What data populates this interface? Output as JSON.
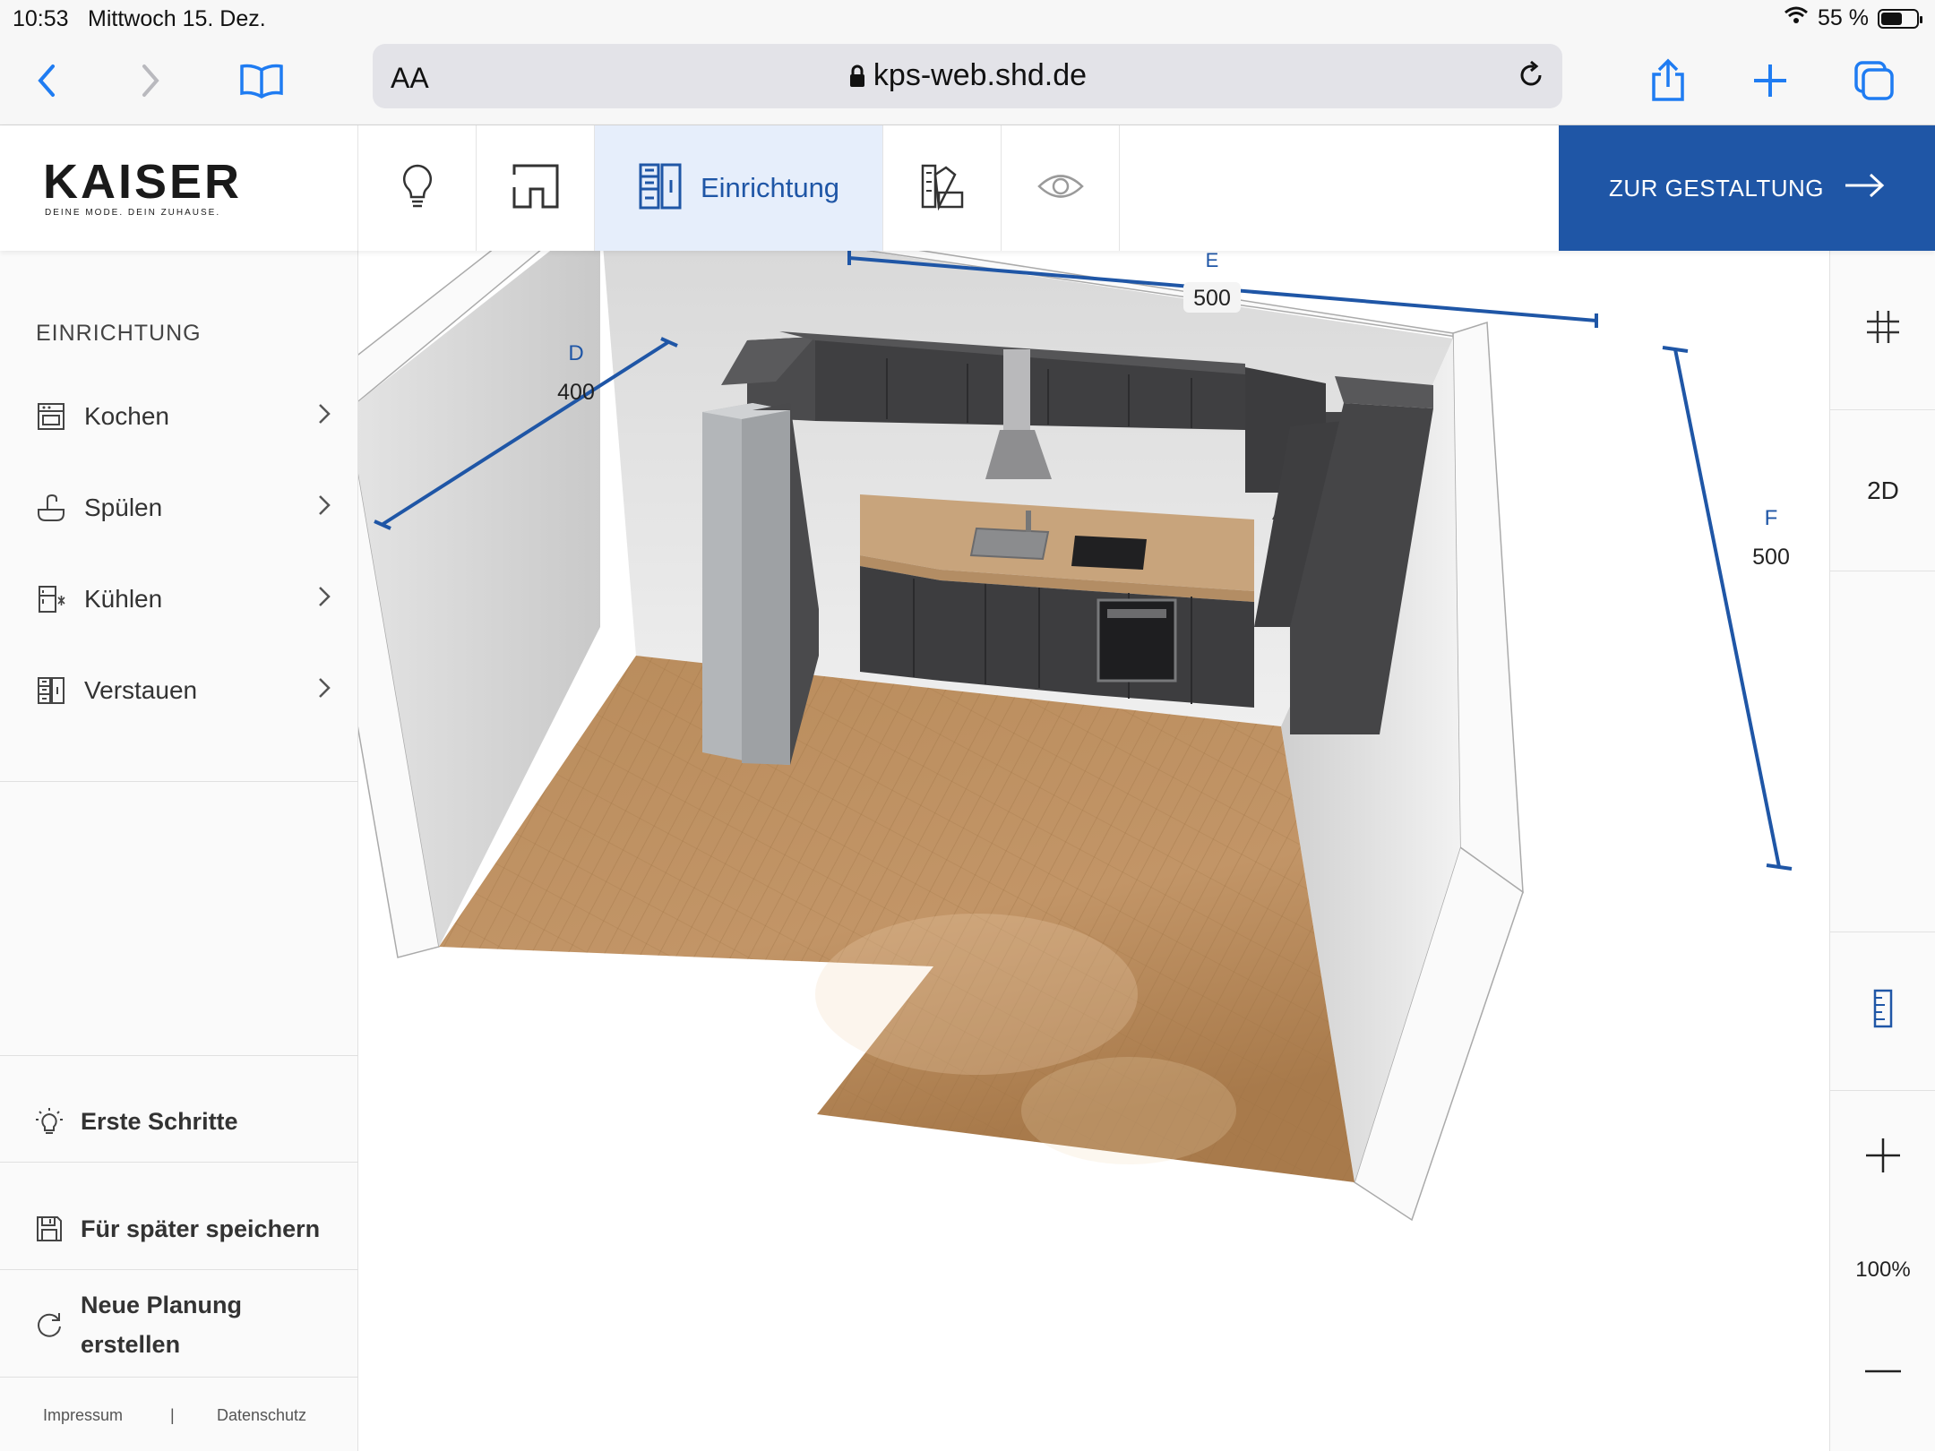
{
  "status": {
    "time": "10:53",
    "date": "Mittwoch 15. Dez.",
    "battery": "55 %"
  },
  "browser": {
    "text_size": "AA",
    "url": "kps-web.shd.de"
  },
  "brand": {
    "name": "KAISER",
    "tagline": "DEINE MODE. DEIN ZUHAUSE.",
    "accent": "#1f56a6"
  },
  "header": {
    "tabs": [
      {
        "icon": "lightbulb-icon"
      },
      {
        "icon": "floorplan-icon"
      },
      {
        "icon": "furnish-icon",
        "label": "Einrichtung",
        "active": true
      },
      {
        "icon": "materials-icon"
      },
      {
        "icon": "eye-icon"
      }
    ],
    "cta_label": "ZUR GESTALTUNG"
  },
  "sidebar": {
    "title": "EINRICHTUNG",
    "items": [
      {
        "label": "Kochen",
        "icon": "oven-icon"
      },
      {
        "label": "Spülen",
        "icon": "sink-icon"
      },
      {
        "label": "Kühlen",
        "icon": "fridge-icon"
      },
      {
        "label": "Verstauen",
        "icon": "cabinet-icon"
      }
    ],
    "actions": [
      {
        "label": "Erste Schritte",
        "icon": "lightbulb-icon"
      },
      {
        "label": "Für später speichern",
        "icon": "save-icon"
      },
      {
        "label": "Neue Planung erstellen",
        "line1": "Neue Planung",
        "line2": "erstellen",
        "icon": "refresh-icon"
      }
    ],
    "footer": {
      "impressum": "Impressum",
      "separator": "|",
      "datenschutz": "Datenschutz"
    }
  },
  "dimensions": [
    {
      "id": "D",
      "value": "400"
    },
    {
      "id": "E",
      "value": "500"
    },
    {
      "id": "F",
      "value": "500"
    }
  ],
  "toolbar_right": {
    "view_toggle": "2D",
    "zoom": "100%"
  }
}
